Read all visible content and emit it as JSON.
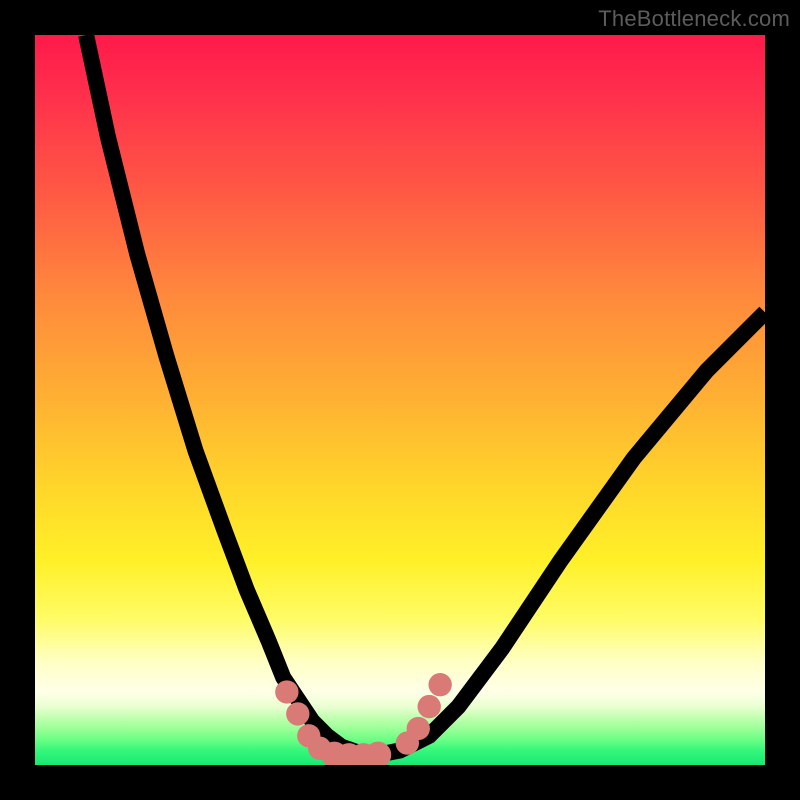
{
  "watermark": "TheBottleneck.com",
  "colors": {
    "frame_bg": "#000000",
    "watermark_text": "#5c5c5c",
    "curve_stroke": "#000000",
    "marker_fill": "#d97a76",
    "gradient_stops": [
      "#ff1a4a",
      "#ff2f4c",
      "#ff5a44",
      "#ff8a3c",
      "#ffb133",
      "#ffd62a",
      "#fff028",
      "#fffc66",
      "#ffffc6",
      "#ffffe8",
      "#eaffd0",
      "#c1ffb0",
      "#9bff98",
      "#6cff85",
      "#35f77a",
      "#18e874"
    ]
  },
  "chart_data": {
    "type": "line",
    "title": "",
    "xlabel": "",
    "ylabel": "",
    "xlim": [
      0,
      100
    ],
    "ylim": [
      0,
      100
    ],
    "grid": false,
    "legend": false,
    "series": [
      {
        "name": "bottleneck-curve",
        "x": [
          7,
          10,
          14,
          18,
          22,
          26,
          29,
          32,
          34,
          36,
          38,
          40,
          42,
          44,
          46,
          48,
          50,
          54,
          58,
          64,
          72,
          82,
          92,
          100
        ],
        "values": [
          100,
          86,
          70,
          56,
          43,
          32,
          24,
          17,
          12,
          9,
          6,
          4,
          2.5,
          1.8,
          1.5,
          1.6,
          2,
          4,
          8,
          16,
          28,
          42,
          54,
          62
        ]
      }
    ],
    "markers": [
      {
        "x": 34.5,
        "y": 10,
        "r": 1.6
      },
      {
        "x": 36,
        "y": 7,
        "r": 1.6
      },
      {
        "x": 37.5,
        "y": 4,
        "r": 1.6
      },
      {
        "x": 39,
        "y": 2.3,
        "r": 1.6
      },
      {
        "x": 41,
        "y": 1.4,
        "r": 1.8
      },
      {
        "x": 43,
        "y": 1.2,
        "r": 1.8
      },
      {
        "x": 45,
        "y": 1.2,
        "r": 1.8
      },
      {
        "x": 47,
        "y": 1.4,
        "r": 1.8
      },
      {
        "x": 51,
        "y": 3,
        "r": 1.6
      },
      {
        "x": 52.5,
        "y": 5,
        "r": 1.6
      },
      {
        "x": 54,
        "y": 8,
        "r": 1.6
      },
      {
        "x": 55.5,
        "y": 11,
        "r": 1.6
      }
    ]
  }
}
